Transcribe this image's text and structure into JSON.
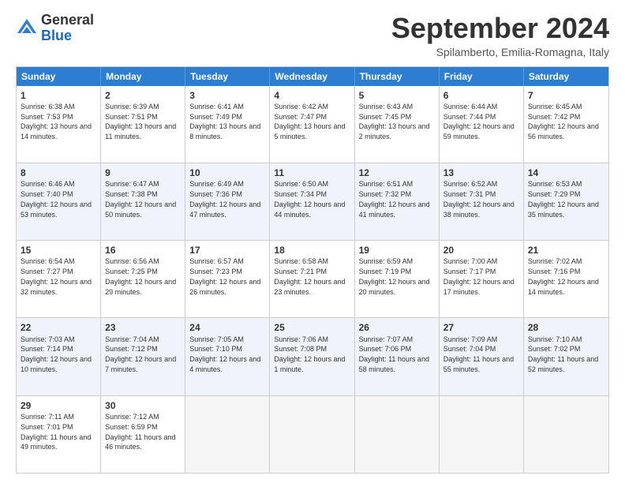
{
  "logo": {
    "general": "General",
    "blue": "Blue"
  },
  "header": {
    "month": "September 2024",
    "location": "Spilamberto, Emilia-Romagna, Italy"
  },
  "days": [
    "Sunday",
    "Monday",
    "Tuesday",
    "Wednesday",
    "Thursday",
    "Friday",
    "Saturday"
  ],
  "rows": [
    [
      {
        "num": "1",
        "rise": "6:38 AM",
        "set": "7:53 PM",
        "daylight": "13 hours and 14 minutes."
      },
      {
        "num": "2",
        "rise": "6:39 AM",
        "set": "7:51 PM",
        "daylight": "13 hours and 11 minutes."
      },
      {
        "num": "3",
        "rise": "6:41 AM",
        "set": "7:49 PM",
        "daylight": "13 hours and 8 minutes."
      },
      {
        "num": "4",
        "rise": "6:42 AM",
        "set": "7:47 PM",
        "daylight": "13 hours and 5 minutes."
      },
      {
        "num": "5",
        "rise": "6:43 AM",
        "set": "7:45 PM",
        "daylight": "13 hours and 2 minutes."
      },
      {
        "num": "6",
        "rise": "6:44 AM",
        "set": "7:44 PM",
        "daylight": "12 hours and 59 minutes."
      },
      {
        "num": "7",
        "rise": "6:45 AM",
        "set": "7:42 PM",
        "daylight": "12 hours and 56 minutes."
      }
    ],
    [
      {
        "num": "8",
        "rise": "6:46 AM",
        "set": "7:40 PM",
        "daylight": "12 hours and 53 minutes."
      },
      {
        "num": "9",
        "rise": "6:47 AM",
        "set": "7:38 PM",
        "daylight": "12 hours and 50 minutes."
      },
      {
        "num": "10",
        "rise": "6:49 AM",
        "set": "7:36 PM",
        "daylight": "12 hours and 47 minutes."
      },
      {
        "num": "11",
        "rise": "6:50 AM",
        "set": "7:34 PM",
        "daylight": "12 hours and 44 minutes."
      },
      {
        "num": "12",
        "rise": "6:51 AM",
        "set": "7:32 PM",
        "daylight": "12 hours and 41 minutes."
      },
      {
        "num": "13",
        "rise": "6:52 AM",
        "set": "7:31 PM",
        "daylight": "12 hours and 38 minutes."
      },
      {
        "num": "14",
        "rise": "6:53 AM",
        "set": "7:29 PM",
        "daylight": "12 hours and 35 minutes."
      }
    ],
    [
      {
        "num": "15",
        "rise": "6:54 AM",
        "set": "7:27 PM",
        "daylight": "12 hours and 32 minutes."
      },
      {
        "num": "16",
        "rise": "6:56 AM",
        "set": "7:25 PM",
        "daylight": "12 hours and 29 minutes."
      },
      {
        "num": "17",
        "rise": "6:57 AM",
        "set": "7:23 PM",
        "daylight": "12 hours and 26 minutes."
      },
      {
        "num": "18",
        "rise": "6:58 AM",
        "set": "7:21 PM",
        "daylight": "12 hours and 23 minutes."
      },
      {
        "num": "19",
        "rise": "6:59 AM",
        "set": "7:19 PM",
        "daylight": "12 hours and 20 minutes."
      },
      {
        "num": "20",
        "rise": "7:00 AM",
        "set": "7:17 PM",
        "daylight": "12 hours and 17 minutes."
      },
      {
        "num": "21",
        "rise": "7:02 AM",
        "set": "7:16 PM",
        "daylight": "12 hours and 14 minutes."
      }
    ],
    [
      {
        "num": "22",
        "rise": "7:03 AM",
        "set": "7:14 PM",
        "daylight": "12 hours and 10 minutes."
      },
      {
        "num": "23",
        "rise": "7:04 AM",
        "set": "7:12 PM",
        "daylight": "12 hours and 7 minutes."
      },
      {
        "num": "24",
        "rise": "7:05 AM",
        "set": "7:10 PM",
        "daylight": "12 hours and 4 minutes."
      },
      {
        "num": "25",
        "rise": "7:06 AM",
        "set": "7:08 PM",
        "daylight": "12 hours and 1 minute."
      },
      {
        "num": "26",
        "rise": "7:07 AM",
        "set": "7:06 PM",
        "daylight": "11 hours and 58 minutes."
      },
      {
        "num": "27",
        "rise": "7:09 AM",
        "set": "7:04 PM",
        "daylight": "11 hours and 55 minutes."
      },
      {
        "num": "28",
        "rise": "7:10 AM",
        "set": "7:02 PM",
        "daylight": "11 hours and 52 minutes."
      }
    ],
    [
      {
        "num": "29",
        "rise": "7:11 AM",
        "set": "7:01 PM",
        "daylight": "11 hours and 49 minutes."
      },
      {
        "num": "30",
        "rise": "7:12 AM",
        "set": "6:59 PM",
        "daylight": "11 hours and 46 minutes."
      },
      null,
      null,
      null,
      null,
      null
    ]
  ]
}
